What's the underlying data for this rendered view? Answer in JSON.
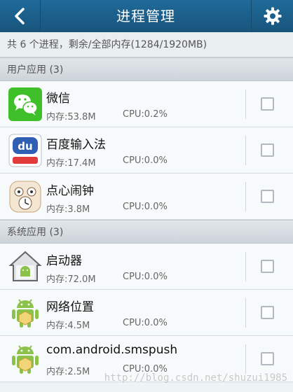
{
  "header": {
    "title": "进程管理"
  },
  "summary": "共 6 个进程，剩余/全部内存(1284/1920MB)",
  "sections": [
    {
      "label": "用户应用 (3)",
      "apps": [
        {
          "name": "微信",
          "memory": "内存:53.8M",
          "cpu": "CPU:0.2%",
          "icon": "wechat-icon"
        },
        {
          "name": "百度输入法",
          "memory": "内存:17.4M",
          "cpu": "CPU:0.0%",
          "icon": "baidu-input-icon"
        },
        {
          "name": "点心闹钟",
          "memory": "内存:3.8M",
          "cpu": "CPU:0.0%",
          "icon": "alarm-clock-icon"
        }
      ]
    },
    {
      "label": "系统应用 (3)",
      "apps": [
        {
          "name": "启动器",
          "memory": "内存:72.0M",
          "cpu": "CPU:0.0%",
          "icon": "launcher-icon"
        },
        {
          "name": "网络位置",
          "memory": "内存:4.5M",
          "cpu": "CPU:0.0%",
          "icon": "android-icon"
        },
        {
          "name": "com.android.smspush",
          "memory": "内存:2.5M",
          "cpu": "CPU:0.0%",
          "icon": "android-icon"
        }
      ]
    }
  ],
  "watermark": "http://blog.csdn.net/shuzui1985",
  "colors": {
    "titlebar": "#1f6a99",
    "wechat": "#3fbf2a",
    "android": "#8bc34a"
  }
}
